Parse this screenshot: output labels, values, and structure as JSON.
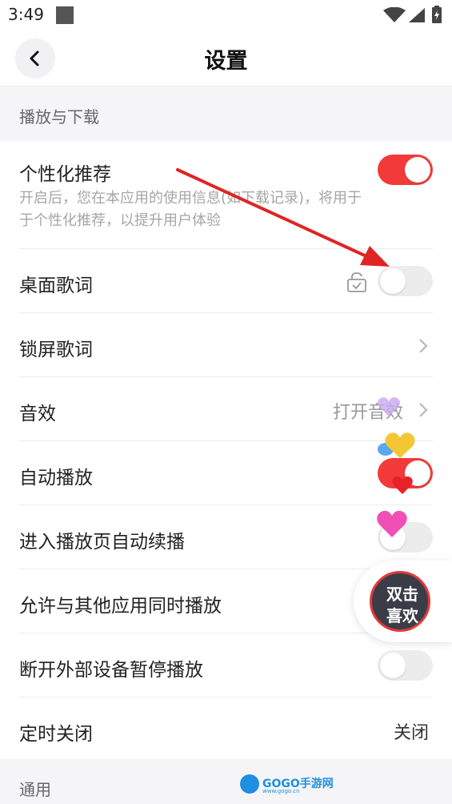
{
  "status_bar": {
    "time": "3:49"
  },
  "nav": {
    "title": "设置",
    "back_icon": "chevron-left-icon"
  },
  "sections": {
    "playback": "播放与下载",
    "general": "通用"
  },
  "settings": {
    "personalized": {
      "label": "个性化推荐",
      "desc": "开启后，您在本应用的使用信息(如下载记录)，将用于于个性化推荐，以提升用户体验",
      "enabled": true
    },
    "desktop_lyrics": {
      "label": "桌面歌词",
      "enabled": false,
      "icon": "lock-icon"
    },
    "lockscreen_lyrics": {
      "label": "锁屏歌词"
    },
    "sound_effect": {
      "label": "音效",
      "value": "打开音效"
    },
    "autoplay": {
      "label": "自动播放",
      "enabled": true
    },
    "auto_continue": {
      "label": "进入播放页自动续播",
      "enabled": false
    },
    "mix_play": {
      "label": "允许与其他应用同时播放",
      "enabled": false
    },
    "pause_on_disconnect": {
      "label": "断开外部设备暂停播放",
      "enabled": false
    },
    "sleep_timer": {
      "label": "定时关闭",
      "value": "关闭"
    }
  },
  "floating_button": {
    "line1": "双击",
    "line2": "喜欢"
  },
  "watermark": {
    "text": "GOGO手游网",
    "sub": "www.gogo.cn"
  },
  "colors": {
    "accent": "#f33a3a",
    "annotation_arrow": "#e02424"
  }
}
